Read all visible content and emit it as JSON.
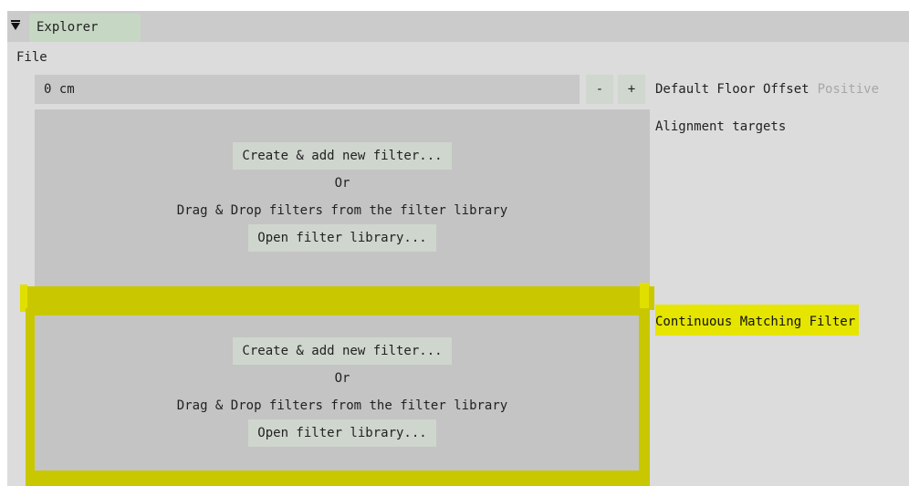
{
  "panel": {
    "tab_title": "Explorer",
    "collapse_icon": "collapse-down-arrow-icon"
  },
  "file_label": "File",
  "floor_offset": {
    "value": "0 cm",
    "minus_label": "-",
    "plus_label": "+",
    "label": "Default Floor Offset",
    "hint": "Positive"
  },
  "alignment_targets": {
    "label": "Alignment targets",
    "create_label": "Create & add new filter...",
    "or_label": "Or",
    "drag_drop_label": "Drag & Drop filters from the filter library",
    "open_library_label": "Open filter library..."
  },
  "continuous_matching": {
    "label": "Continuous Matching Filter",
    "create_label": "Create & add new filter...",
    "or_label": "Or",
    "drag_drop_label": "Drag & Drop filters from the filter library",
    "open_library_label": "Open filter library..."
  },
  "colors": {
    "panel_bg": "#dcdcdc",
    "titlebar_bg": "#cbcbcb",
    "tab_bg": "#c6d8c4",
    "slot_bg": "#c4c4c4",
    "button_bg": "#cfd6ce",
    "highlight": "#e5e500",
    "highlight_dark": "#c9c800"
  }
}
